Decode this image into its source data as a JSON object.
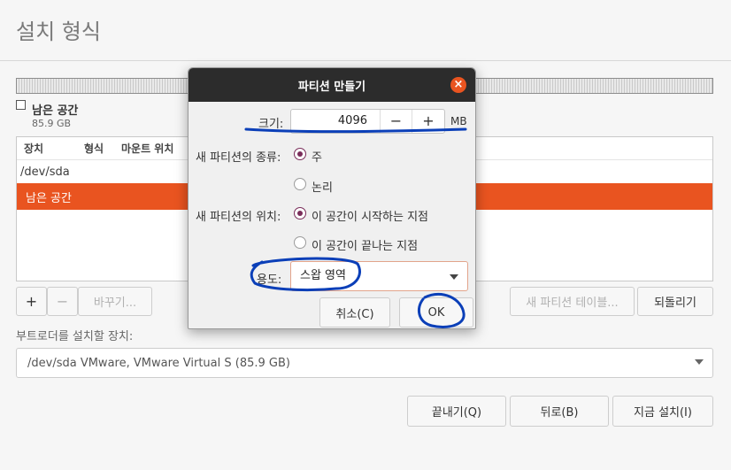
{
  "page": {
    "title": "설치 형식"
  },
  "legend": {
    "label": "남은 공간",
    "size": "85.9 GB"
  },
  "table": {
    "columns": [
      "장치",
      "형식",
      "마운트 위치"
    ],
    "rows": [
      {
        "device": "/dev/sda",
        "selected": false
      },
      {
        "device": "남은 공간",
        "selected": true
      }
    ]
  },
  "partition_buttons": {
    "add": "+",
    "remove": "−",
    "change": "바꾸기...",
    "new_table": "새 파티션 테이블...",
    "revert": "되돌리기"
  },
  "bootloader": {
    "label": "부트로더를 설치할 장치:",
    "value": "/dev/sda VMware, VMware Virtual S (85.9 GB)"
  },
  "nav": {
    "quit": "끝내기(Q)",
    "back": "뒤로(B)",
    "install": "지금 설치(I)"
  },
  "dialog": {
    "title": "파티션 만들기",
    "close": "×",
    "size_label": "크기:",
    "size_value": "4096",
    "minus": "−",
    "plus": "+",
    "unit": "MB",
    "type_label": "새 파티션의 종류:",
    "type_options": [
      {
        "label": "주",
        "checked": true
      },
      {
        "label": "논리",
        "checked": false
      }
    ],
    "location_label": "새 파티션의 위치:",
    "location_options": [
      {
        "label": "이 공간이 시작하는 지점",
        "checked": true
      },
      {
        "label": "이 공간이 끝나는 지점",
        "checked": false
      }
    ],
    "use_label": "용도:",
    "use_value": "스왑 영역",
    "cancel": "취소(C)",
    "ok": "OK"
  },
  "colors": {
    "accent": "#e95420",
    "header": "#2c2c2c",
    "annotation": "#0b3fb8"
  }
}
